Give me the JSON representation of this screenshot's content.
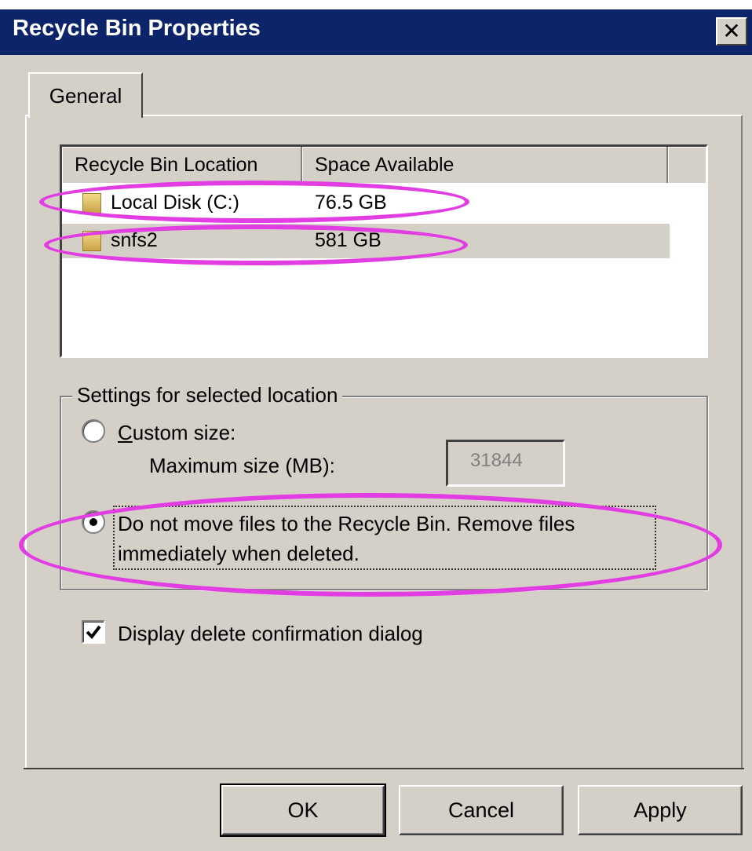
{
  "window": {
    "title": "Recycle Bin Properties",
    "close_glyph": "✕"
  },
  "tabs": [
    {
      "label": "General",
      "selected": true
    }
  ],
  "locations": {
    "columns": [
      "Recycle Bin Location",
      "Space Available"
    ],
    "rows": [
      {
        "icon": "folder-icon",
        "name": "Local Disk (C:)",
        "space": "76.5 GB",
        "selected": false
      },
      {
        "icon": "folder-icon",
        "name": "snfs2",
        "space": "581 GB",
        "selected": true
      }
    ]
  },
  "settings": {
    "group_label": "Settings for selected location",
    "custom_size": {
      "label": "Custom size:",
      "mnemonic": "C",
      "selected": false
    },
    "max_size": {
      "label": "Maximum size (MB):",
      "mnemonic": "a",
      "value": "31844",
      "enabled": false
    },
    "do_not_move": {
      "line1": "Do not move files to the Recycle Bin. Remove files",
      "line2": "immediately when deleted.",
      "mnemonic": "R",
      "selected": true
    }
  },
  "confirm_dialog": {
    "label": "Display delete confirmation dialog",
    "mnemonic": "D",
    "checked": true
  },
  "buttons": {
    "ok": "OK",
    "cancel": "Cancel",
    "apply": "Apply"
  },
  "colors": {
    "titlebar": "#0c246a",
    "annotation": "#e23de3",
    "face": "#d4d0c8"
  }
}
